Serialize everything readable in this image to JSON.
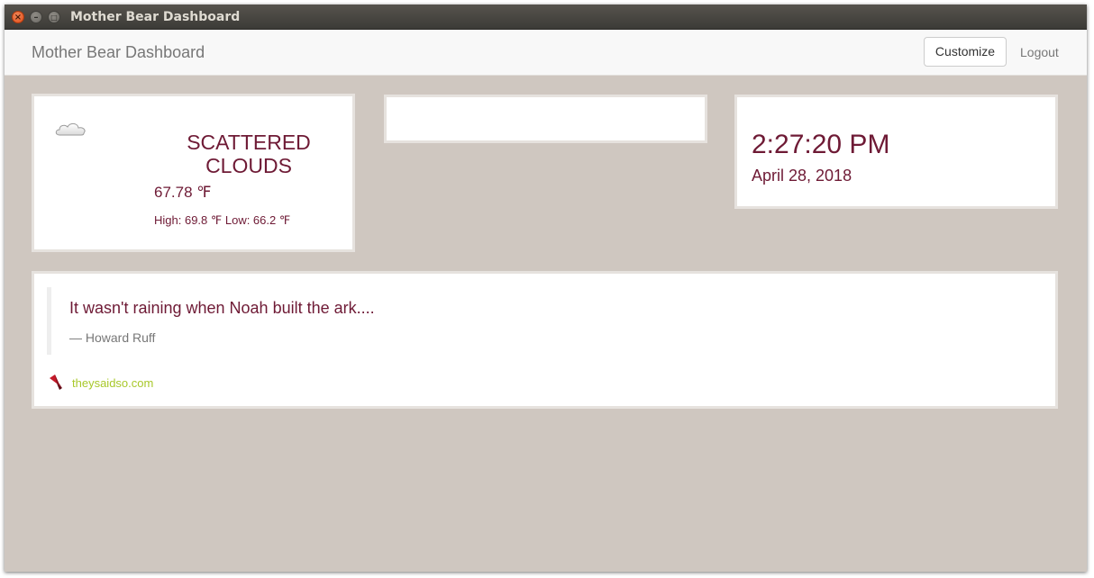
{
  "window": {
    "title": "Mother Bear Dashboard",
    "close_glyph": "×",
    "minimize_glyph": "–",
    "maximize_glyph": "□"
  },
  "navbar": {
    "brand": "Mother Bear Dashboard",
    "customize_label": "Customize",
    "logout_label": "Logout"
  },
  "weather": {
    "icon": "cloud-icon",
    "condition": "SCATTERED CLOUDS",
    "temperature": "67.78 ℉",
    "high_low": "High: 69.8 ℉ Low: 66.2 ℉"
  },
  "clock": {
    "time": "2:27:20 PM",
    "date": "April 28, 2018"
  },
  "quote": {
    "text": "It wasn't raining when Noah built the ark....",
    "author": "— Howard Ruff",
    "source_icon": "bookmark-icon",
    "source_link": "theysaidso.com"
  },
  "colors": {
    "background": "#cfc7c0",
    "accent": "#6e1a35",
    "link": "#a8c82a"
  }
}
